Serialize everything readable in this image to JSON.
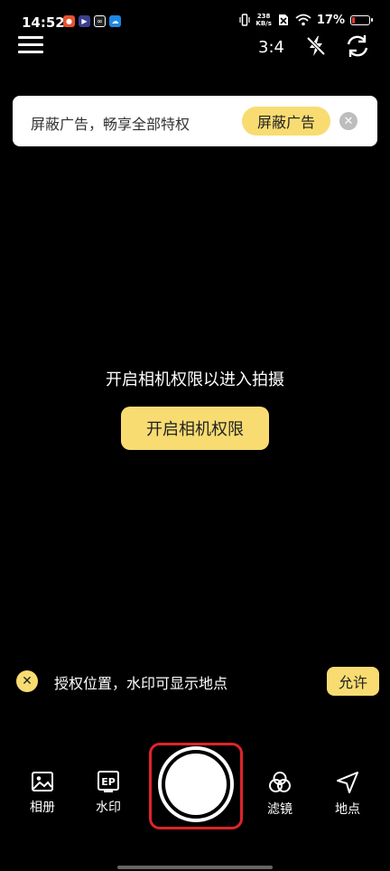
{
  "status_bar": {
    "time": "14:52",
    "net_speed_value": "238",
    "net_speed_unit": "KB/s",
    "battery_percent": "17%",
    "battery_level": 0.17,
    "battery_color": "#e53935"
  },
  "toolbar": {
    "aspect_ratio": "3:4",
    "menu_icon": "menu-icon",
    "flash_icon": "flash-off-icon",
    "flip_icon": "camera-flip-icon"
  },
  "ad_banner": {
    "text": "屏蔽广告，畅享全部特权",
    "button_label": "屏蔽广告",
    "close_glyph": "✕"
  },
  "permission": {
    "prompt": "开启相机权限以进入拍摄",
    "button_label": "开启相机权限"
  },
  "location": {
    "close_glyph": "✕",
    "message": "授权位置，水印可显示地点",
    "allow_label": "允许"
  },
  "bottom_bar": {
    "album_label": "相册",
    "watermark_label": "水印",
    "filter_label": "滤镜",
    "place_label": "地点"
  },
  "colors": {
    "accent": "#f8dc72",
    "background": "#000000",
    "highlight_frame": "#e0232b"
  }
}
